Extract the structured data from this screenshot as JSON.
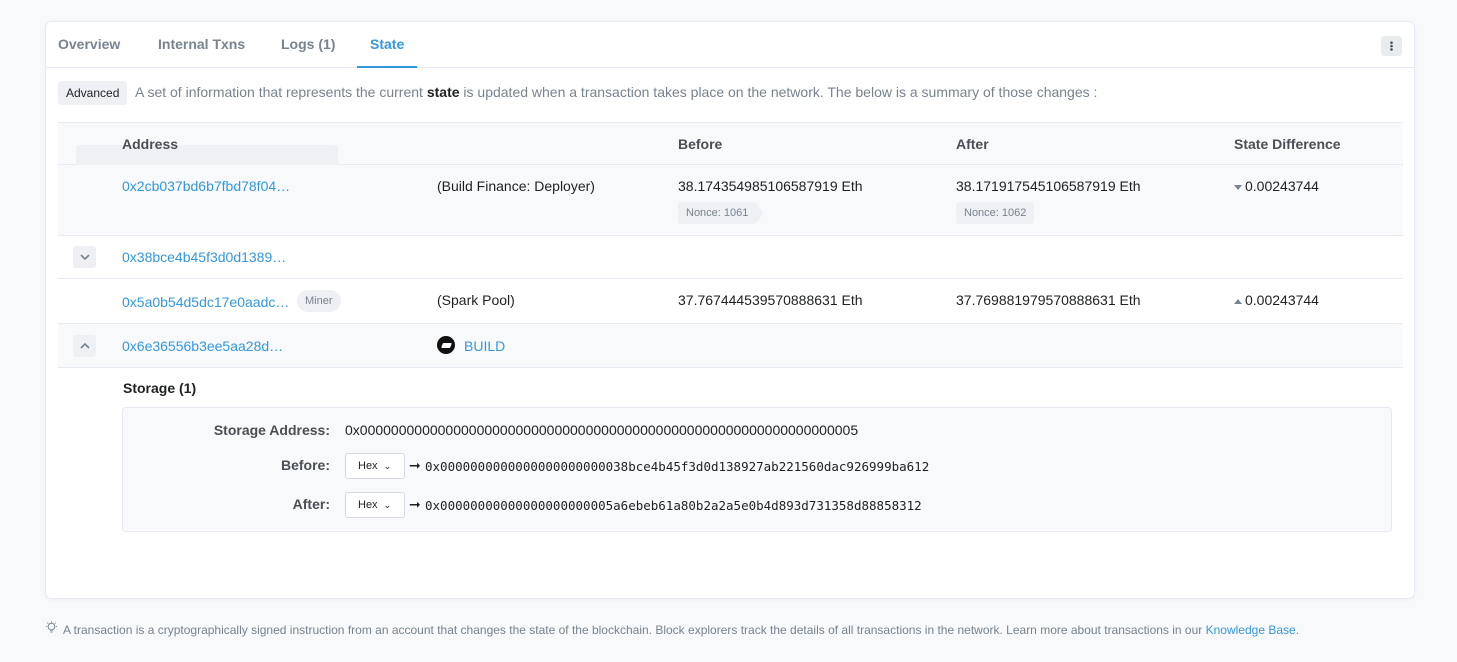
{
  "tabs": [
    {
      "label": "Overview"
    },
    {
      "label": "Internal Txns"
    },
    {
      "label": "Logs (1)"
    },
    {
      "label": "State"
    }
  ],
  "more_icon": "vertical-ellipsis-icon",
  "intro": {
    "badge": "Advanced",
    "text_before": "A set of information that represents the current",
    "bold": "state",
    "text_after": "is updated when a transaction takes place on the network. The below is a summary of those changes :"
  },
  "table": {
    "headers": {
      "address": "Address",
      "before": "Before",
      "after": "After",
      "diff": "State Difference"
    },
    "rows": [
      {
        "address": "0x2cb037bd6b7fbd78f04…",
        "label": "(Build Finance: Deployer)",
        "before": "38.174354985106587919 Eth",
        "after": "38.171917545106587919 Eth",
        "before_nonce": "Nonce: 1061",
        "after_nonce": "Nonce: 1062",
        "diff": "0.00243744",
        "diff_direction": "down"
      },
      {
        "address": "0x38bce4b45f3d0d1389…"
      },
      {
        "address": "0x5a0b54d5dc17e0aadc…",
        "badge": "Miner",
        "label": "(Spark Pool)",
        "before": "37.767444539570888631 Eth",
        "after": "37.769881979570888631 Eth",
        "diff": "0.00243744",
        "diff_direction": "up"
      },
      {
        "address": "0x6e36556b3ee5aa28d…",
        "token": "BUILD"
      }
    ]
  },
  "storage": {
    "title": "Storage (1)",
    "address_label": "Storage Address:",
    "address_value": "0x0000000000000000000000000000000000000000000000000000000000000005",
    "before_label": "Before:",
    "after_label": "After:",
    "format": "Hex",
    "before_value": "0x0000000000000000000000038bce4b45f3d0d138927ab221560dac926999ba612",
    "after_value": "0x00000000000000000000005a6ebeb61a80b2a2a5e0b4d893d731358d88858312"
  },
  "footer": {
    "text": "A transaction is a cryptographically signed instruction from an account that changes the state of the blockchain. Block explorers track the details of all transactions in the network. Learn more about transactions in our",
    "link": "Knowledge Base",
    "end": "."
  },
  "colors": {
    "accent": "#3498db",
    "muted": "#77838f"
  }
}
